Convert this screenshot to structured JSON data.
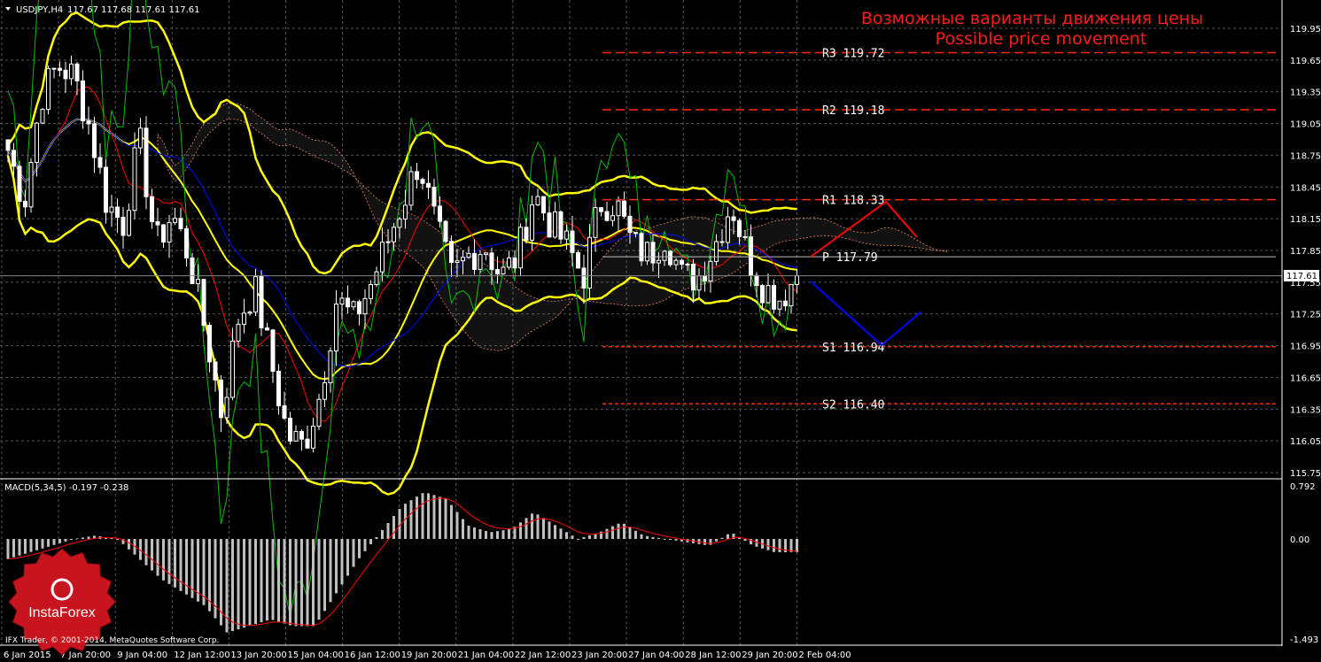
{
  "header": {
    "symbol": "USDJPY,H4",
    "ohlc": "117.67 117.68 117.61 117.61"
  },
  "annotation": {
    "title_ru": "Возможные варианты движения цены",
    "title_en": "Possible price movement"
  },
  "copyright": "IFX Trader, © 2001-2014, MetaQuotes Software Corp.",
  "logo": {
    "text": "InstaForex"
  },
  "colors": {
    "background": "#000000",
    "bands": "#ffff00",
    "pivot": "#ff2a00",
    "up_path": "#ff0000",
    "down_path": "#0000ff",
    "macd_signal": "#ff0000",
    "macd_hist": "#c0c0c0",
    "green_line": "#00c000"
  },
  "chart_data": [
    {
      "type": "candlestick",
      "title": "USDJPY,H4",
      "ylim": [
        115.75,
        119.95
      ],
      "y_ticks": [
        "119.95",
        "119.65",
        "119.35",
        "119.05",
        "118.75",
        "118.45",
        "118.15",
        "117.85",
        "117.55",
        "117.25",
        "116.95",
        "116.65",
        "116.35",
        "116.05",
        "115.75"
      ],
      "current_price": "117.61",
      "x_ticks": [
        "6 Jan 2015",
        "7 Jan 20:00",
        "9 Jan 04:00",
        "12 Jan 12:00",
        "13 Jan 20:00",
        "15 Jan 04:00",
        "16 Jan 12:00",
        "19 Jan 20:00",
        "21 Jan 04:00",
        "22 Jan 12:00",
        "23 Jan 20:00",
        "27 Jan 04:00",
        "28 Jan 12:00",
        "29 Jan 20:00",
        "2 Feb 04:00"
      ],
      "approx_closes": [
        118.8,
        118.3,
        119.3,
        119.6,
        119.5,
        119.0,
        118.3,
        118.1,
        118.9,
        117.9,
        118.2,
        117.8,
        117.1,
        116.3,
        117.2,
        117.5,
        116.8,
        116.1,
        116.0,
        116.5,
        117.4,
        117.2,
        117.5,
        117.9,
        118.3,
        118.7,
        118.1,
        117.6,
        117.8,
        117.9,
        117.6,
        117.8,
        118.4,
        118.1,
        117.9,
        117.6,
        118.3,
        118.3,
        117.9,
        117.8,
        118.0,
        117.6,
        117.6,
        117.9,
        118.3,
        117.8,
        117.5,
        117.4,
        117.61
      ],
      "pivots": [
        {
          "label": "R3 119.72",
          "value": 119.72
        },
        {
          "label": "R2 119.18",
          "value": 119.18
        },
        {
          "label": "R1 118.33",
          "value": 118.33
        },
        {
          "label": "P 117.79",
          "value": 117.79
        },
        {
          "label": "S1 116.94",
          "value": 116.94
        },
        {
          "label": "S2 116.40",
          "value": 116.4
        }
      ]
    },
    {
      "type": "bar",
      "title": "MACD(5,34,5) -0.197 -0.238",
      "ylim": [
        -1.493,
        0.792
      ],
      "y_ticks": [
        "0.792",
        "0.00",
        "-1.493"
      ],
      "approx_hist": [
        -0.3,
        -0.2,
        -0.1,
        0.0,
        0.05,
        0.0,
        -0.3,
        -0.6,
        -0.8,
        -1.0,
        -1.4,
        -1.3,
        -1.2,
        -1.3,
        -1.3,
        -0.8,
        -0.3,
        0.1,
        0.5,
        0.7,
        0.6,
        0.2,
        0.1,
        0.15,
        0.4,
        0.2,
        0.0,
        0.1,
        0.25,
        0.05,
        0.0,
        -0.05,
        -0.1,
        0.1,
        -0.1,
        -0.2,
        -0.197
      ]
    }
  ]
}
